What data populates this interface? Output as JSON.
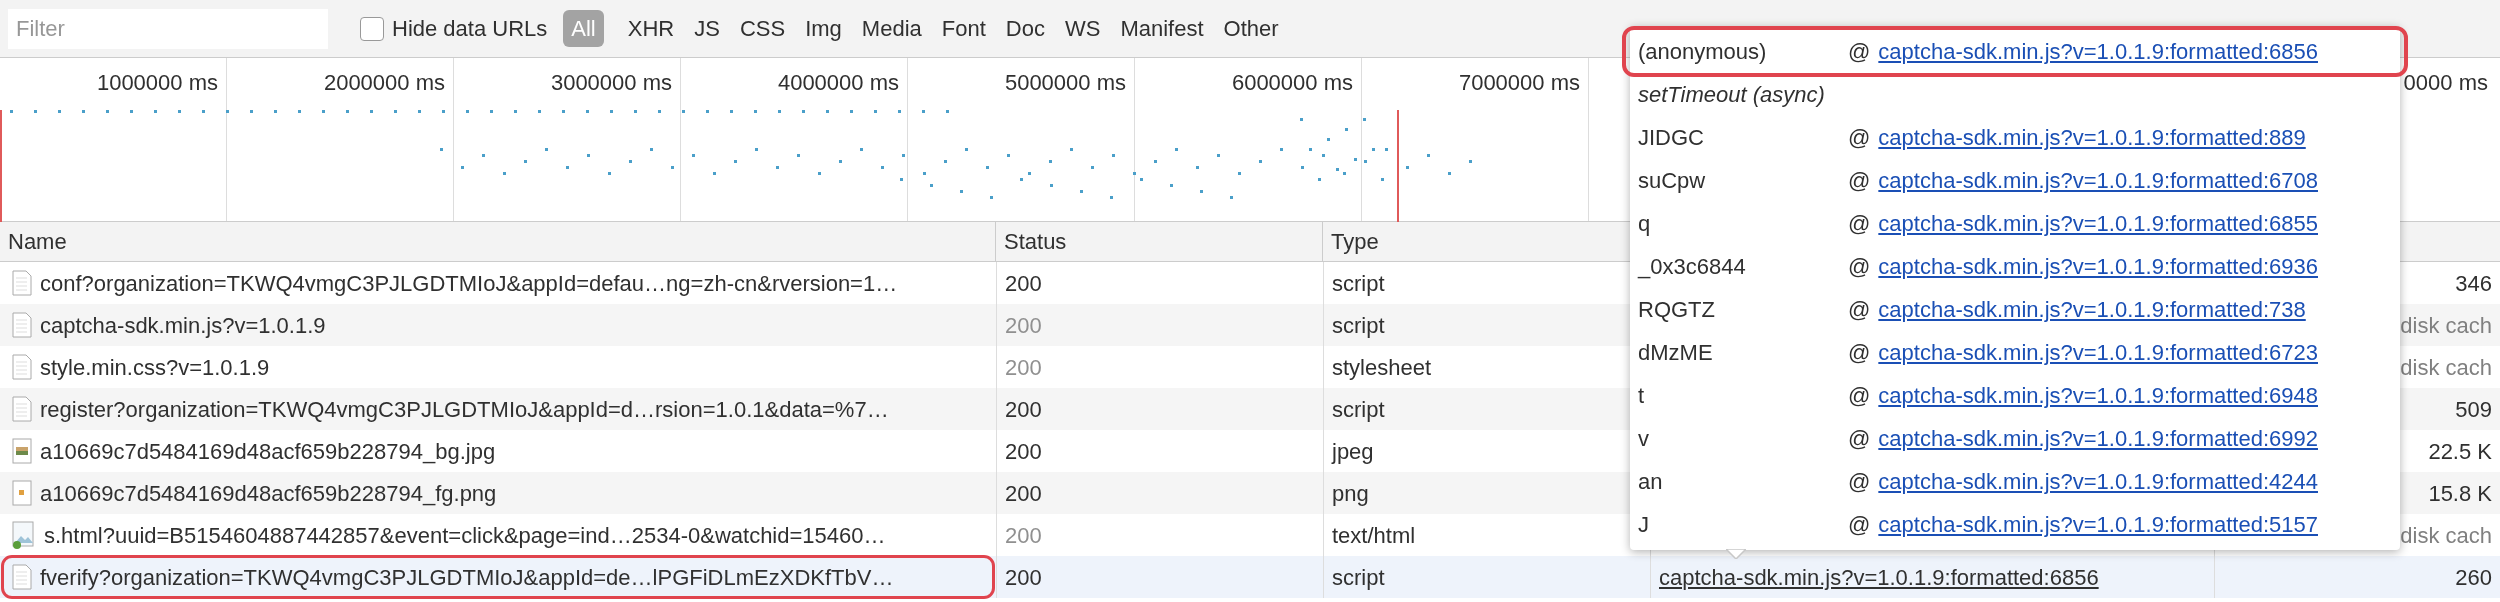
{
  "toolbar": {
    "filter": {
      "placeholder": "Filter"
    },
    "hide_data_urls": {
      "label": "Hide data URLs",
      "checked": false
    },
    "types": [
      {
        "label": "All",
        "selected": true
      },
      {
        "label": "XHR",
        "selected": false
      },
      {
        "label": "JS",
        "selected": false
      },
      {
        "label": "CSS",
        "selected": false
      },
      {
        "label": "Img",
        "selected": false
      },
      {
        "label": "Media",
        "selected": false
      },
      {
        "label": "Font",
        "selected": false
      },
      {
        "label": "Doc",
        "selected": false
      },
      {
        "label": "WS",
        "selected": false
      },
      {
        "label": "Manifest",
        "selected": false
      },
      {
        "label": "Other",
        "selected": false
      }
    ]
  },
  "timeline": {
    "ticks": [
      "1000000 ms",
      "2000000 ms",
      "3000000 ms",
      "4000000 ms",
      "5000000 ms",
      "6000000 ms",
      "7000000 ms",
      "0000 ms"
    ]
  },
  "table": {
    "columns": [
      "Name",
      "Status",
      "Type"
    ],
    "rows": [
      {
        "kind": "document",
        "name": "conf?organization=TKWQ4vmgC3PJLGDTMIoJ&appId=defau…ng=zh-cn&rversion=1…",
        "status": "200",
        "cached": false,
        "type": "script",
        "size": "346",
        "selected": false
      },
      {
        "kind": "document",
        "name": "captcha-sdk.min.js?v=1.0.1.9",
        "status": "200",
        "cached": true,
        "type": "script",
        "size": "disk cach",
        "selected": false
      },
      {
        "kind": "document",
        "name": "style.min.css?v=1.0.1.9",
        "status": "200",
        "cached": true,
        "type": "stylesheet",
        "size": "disk cach",
        "selected": false
      },
      {
        "kind": "document",
        "name": "register?organization=TKWQ4vmgC3PJLGDTMIoJ&appId=d…rsion=1.0.1&data=%7…",
        "status": "200",
        "cached": false,
        "type": "script",
        "size": "509",
        "selected": false
      },
      {
        "kind": "photo",
        "name": "a10669c7d5484169d48acf659b228794_bg.jpg",
        "status": "200",
        "cached": false,
        "type": "jpeg",
        "size": "22.5 K",
        "selected": false
      },
      {
        "kind": "small-image",
        "name": "a10669c7d5484169d48acf659b228794_fg.png",
        "status": "200",
        "cached": false,
        "type": "png",
        "size": "15.8 K",
        "selected": false
      },
      {
        "kind": "image-file",
        "name": "s.html?uuid=B5154604887442857&event=click&page=ind…2534-0&watchid=15460…",
        "status": "200",
        "cached": true,
        "type": "text/html",
        "size": "disk cach",
        "selected": false
      },
      {
        "kind": "document",
        "name": "fverify?organization=TKWQ4vmgC3PJLGDTMIoJ&appId=de…lPGFiDLmEzXDKfTbV…",
        "status": "200",
        "cached": false,
        "type": "script",
        "initiator": "captcha-sdk.min.js?v=1.0.1.9:formatted:6856",
        "size": "260",
        "selected": true
      }
    ]
  },
  "stack_popover": {
    "frames": [
      {
        "kind": "frame",
        "function": "(anonymous)",
        "at": "@",
        "location": "captcha-sdk.min.js?v=1.0.1.9:formatted:6856",
        "selected": true
      },
      {
        "kind": "async",
        "function": "setTimeout (async)",
        "selected": false
      },
      {
        "kind": "frame",
        "function": "JIDGC",
        "at": "@",
        "location": "captcha-sdk.min.js?v=1.0.1.9:formatted:889",
        "selected": false
      },
      {
        "kind": "frame",
        "function": "suCpw",
        "at": "@",
        "location": "captcha-sdk.min.js?v=1.0.1.9:formatted:6708",
        "selected": false
      },
      {
        "kind": "frame",
        "function": "q",
        "at": "@",
        "location": "captcha-sdk.min.js?v=1.0.1.9:formatted:6855",
        "selected": false
      },
      {
        "kind": "frame",
        "function": "_0x3c6844",
        "at": "@",
        "location": "captcha-sdk.min.js?v=1.0.1.9:formatted:6936",
        "selected": false
      },
      {
        "kind": "frame",
        "function": "RQGTZ",
        "at": "@",
        "location": "captcha-sdk.min.js?v=1.0.1.9:formatted:738",
        "selected": false
      },
      {
        "kind": "frame",
        "function": "dMzME",
        "at": "@",
        "location": "captcha-sdk.min.js?v=1.0.1.9:formatted:6723",
        "selected": false
      },
      {
        "kind": "frame",
        "function": "t",
        "at": "@",
        "location": "captcha-sdk.min.js?v=1.0.1.9:formatted:6948",
        "selected": false
      },
      {
        "kind": "frame",
        "function": "v",
        "at": "@",
        "location": "captcha-sdk.min.js?v=1.0.1.9:formatted:6992",
        "selected": false
      },
      {
        "kind": "frame",
        "function": "an",
        "at": "@",
        "location": "captcha-sdk.min.js?v=1.0.1.9:formatted:4244",
        "selected": false
      },
      {
        "kind": "frame",
        "function": "J",
        "at": "@",
        "location": "captcha-sdk.min.js?v=1.0.1.9:formatted:5157",
        "selected": false
      }
    ]
  }
}
